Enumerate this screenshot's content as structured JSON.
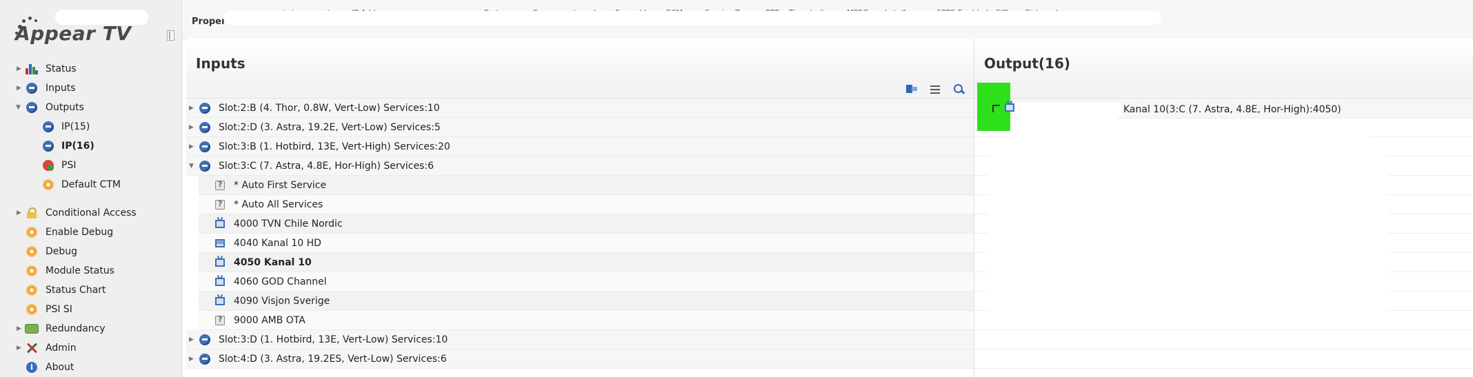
{
  "app": {
    "brand": "Appear TV"
  },
  "nav": {
    "items": [
      {
        "id": "status",
        "label": "Status",
        "expandable": true
      },
      {
        "id": "inputs",
        "label": "Inputs",
        "expandable": true
      },
      {
        "id": "outputs",
        "label": "Outputs",
        "expandable": true,
        "expanded": true
      },
      {
        "id": "ip15",
        "label": "IP(15)"
      },
      {
        "id": "ip16",
        "label": "IP(16)",
        "active": true
      },
      {
        "id": "psi",
        "label": "PSI"
      },
      {
        "id": "default-ctm",
        "label": "Default CTM"
      },
      {
        "id": "conditional-access",
        "label": "Conditional Access",
        "expandable": true
      },
      {
        "id": "enable-debug",
        "label": "Enable Debug"
      },
      {
        "id": "debug",
        "label": "Debug"
      },
      {
        "id": "module-status",
        "label": "Module Status"
      },
      {
        "id": "status-chart",
        "label": "Status Chart"
      },
      {
        "id": "psi-si",
        "label": "PSI SI"
      },
      {
        "id": "redundancy",
        "label": "Redundancy",
        "expandable": true
      },
      {
        "id": "admin",
        "label": "Admin",
        "expandable": true
      },
      {
        "id": "about",
        "label": "About"
      }
    ]
  },
  "header": {
    "properties": "Properties",
    "columns": [
      "...ic increment",
      "IP Address",
      "Port",
      "Component mode",
      "Scrambler",
      "ECM",
      "Service Type",
      "RTP",
      "Time to live",
      "MPEG packets/frame",
      "SPTS Enabled",
      "SID conflict mode"
    ]
  },
  "inputs": {
    "title": "Inputs",
    "rows": [
      {
        "type": "slot",
        "label": "Slot:2:B (4. Thor, 0.8W, Vert-Low) Services:10",
        "expanded": false
      },
      {
        "type": "slot",
        "label": "Slot:2:D (3. Astra, 19.2E, Vert-Low) Services:5",
        "expanded": false
      },
      {
        "type": "slot",
        "label": "Slot:3:B (1. Hotbird, 13E, Vert-High) Services:20",
        "expanded": false
      },
      {
        "type": "slot",
        "label": "Slot:3:C (7. Astra, 4.8E, Hor-High) Services:6",
        "expanded": true
      },
      {
        "type": "service",
        "icon": "auto-service-icon",
        "label": "* Auto First Service"
      },
      {
        "type": "service",
        "icon": "auto-service-icon",
        "label": "* Auto All Services"
      },
      {
        "type": "service",
        "icon": "tv-icon",
        "label": "4000 TVN Chile Nordic"
      },
      {
        "type": "service",
        "icon": "hd-tv-icon",
        "label": "4040 Kanal 10 HD"
      },
      {
        "type": "service",
        "icon": "tv-icon",
        "label": "4050 Kanal 10",
        "bold": true
      },
      {
        "type": "service",
        "icon": "tv-icon",
        "label": "4060 GOD Channel"
      },
      {
        "type": "service",
        "icon": "tv-icon",
        "label": "4090 Visjon Sverige"
      },
      {
        "type": "service",
        "icon": "auto-service-icon",
        "label": "9000 AMB OTA"
      },
      {
        "type": "slot",
        "label": "Slot:3:D (1. Hotbird, 13E, Vert-Low) Services:10",
        "expanded": false
      },
      {
        "type": "slot",
        "label": "Slot:4:D (3. Astra, 19.2ES, Vert-Low) Services:6",
        "expanded": false
      }
    ]
  },
  "output": {
    "title": "Output(16)",
    "rows": [
      {
        "label": "Kanal 10(3:C (7. Astra, 4.8E, Hor-High):4050)"
      }
    ]
  },
  "colors": {
    "highlight_green": "#2ee01c",
    "sidebar_bg": "#efefef"
  }
}
